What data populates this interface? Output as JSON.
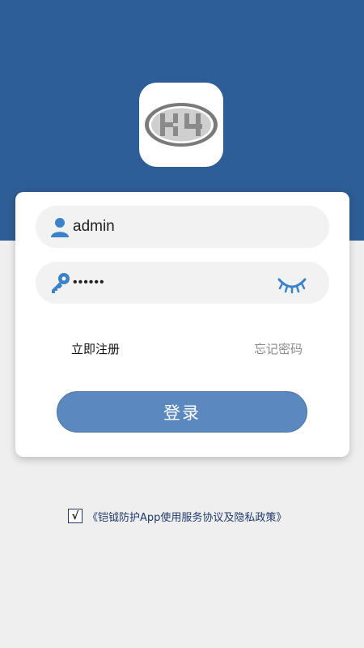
{
  "colors": {
    "header": "#2e5e97",
    "background": "#efefef",
    "button": "#5b88bf",
    "icon_blue": "#3b82c9"
  },
  "logo": {
    "icon": "k4-logo",
    "text": "K4"
  },
  "login": {
    "username_value": "admin",
    "username_icon": "user-icon",
    "password_value": "••••••",
    "password_icon": "key-icon",
    "toggle_icon": "eye-closed-icon",
    "register_label": "立即注册",
    "forgot_label": "忘记密码",
    "submit_label": "登录"
  },
  "agreement": {
    "checked_mark": "√",
    "text": "《铠钺防护App使用服务协议及隐私政策》"
  }
}
